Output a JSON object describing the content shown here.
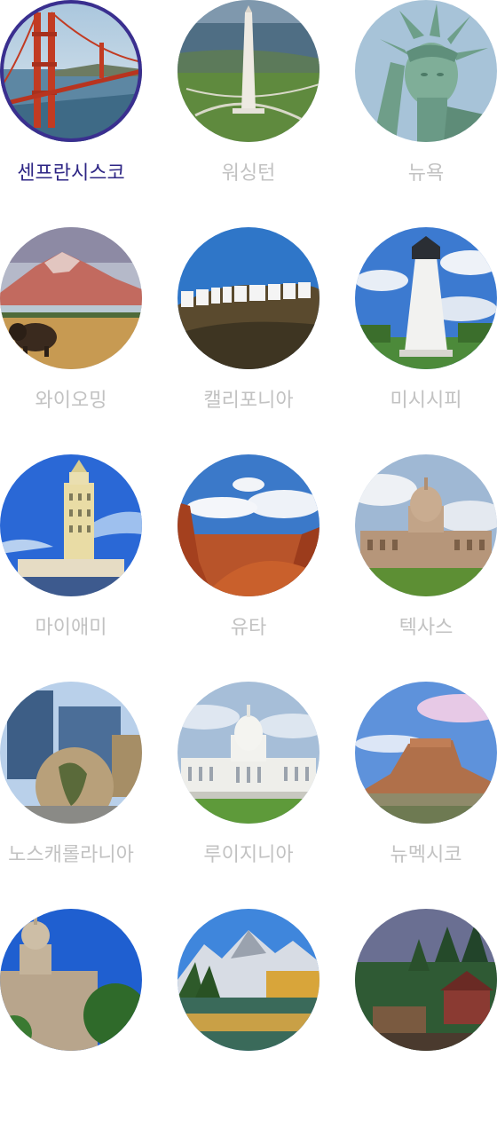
{
  "selected_index": 0,
  "colors": {
    "selected_text": "#2e2685",
    "unselected_text": "#c2c2c2",
    "selected_ring": "#3a2f8f"
  },
  "cities": [
    {
      "name": "센프란시스코",
      "image": "golden-gate-bridge-image",
      "selected": true
    },
    {
      "name": "워싱턴",
      "image": "washington-monument-image",
      "selected": false
    },
    {
      "name": "뉴욕",
      "image": "statue-of-liberty-image",
      "selected": false
    },
    {
      "name": "와이오밍",
      "image": "bison-mountain-image",
      "selected": false
    },
    {
      "name": "캘리포니아",
      "image": "hollywood-sign-image",
      "selected": false
    },
    {
      "name": "미시시피",
      "image": "lighthouse-image",
      "selected": false
    },
    {
      "name": "마이애미",
      "image": "freedom-tower-image",
      "selected": false
    },
    {
      "name": "유타",
      "image": "red-rock-mesa-image",
      "selected": false
    },
    {
      "name": "텍사스",
      "image": "texas-capitol-image",
      "selected": false
    },
    {
      "name": "노스캐롤라니아",
      "image": "globe-museum-image",
      "selected": false
    },
    {
      "name": "루이지니아",
      "image": "us-capitol-image",
      "selected": false
    },
    {
      "name": "뉴멕시코",
      "image": "desert-butte-image",
      "selected": false
    },
    {
      "name": "",
      "image": "capitol-building-image",
      "selected": false
    },
    {
      "name": "",
      "image": "mountain-lake-image",
      "selected": false
    },
    {
      "name": "",
      "image": "forest-town-image",
      "selected": false
    }
  ]
}
